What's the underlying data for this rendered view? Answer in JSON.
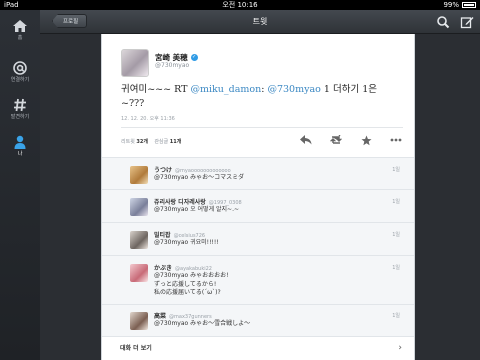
{
  "status_bar": {
    "device": "iPad",
    "time": "오전 10:16",
    "battery": "99%"
  },
  "sidebar": {
    "items": [
      {
        "label": "홈",
        "icon": "home-icon"
      },
      {
        "label": "연결하기",
        "icon": "at-icon"
      },
      {
        "label": "발견하기",
        "icon": "hashtag-icon"
      },
      {
        "label": "나",
        "icon": "person-icon"
      }
    ]
  },
  "header": {
    "back_label": "프로필",
    "title": "트윗",
    "icons": [
      "search-icon",
      "compose-icon"
    ]
  },
  "tweet": {
    "author_name": "宮崎 美穂",
    "handle": "@730myao",
    "text_prefix": "귀여미~~~ RT ",
    "mention1": "@miku_damon",
    "text_middle": ": ",
    "mention2": "@730myao",
    "text_suffix": " 1 더하기 1은 ~???",
    "timestamp": "12. 12. 20. 오후 11:36",
    "retweets_label": "리트윗",
    "retweets_count": "32개",
    "favorites_label": "관심글",
    "favorites_count": "11개",
    "actions": [
      "reply-icon",
      "retweet-icon",
      "favorite-icon",
      "more-icon"
    ]
  },
  "replies": [
    {
      "name": "うつけ",
      "handle": "@myaooooooooooooo",
      "text": "@730myao みゃお～コマスミダ",
      "time": "1일"
    },
    {
      "name": "쥬리사랑 디자레사랑",
      "handle": "@1997_0308",
      "text": "@730myao 오 어떻게 알지~.~",
      "time": "1일"
    },
    {
      "name": "밀티팝",
      "handle": "@celsius726",
      "text": "@730myao 귀요미!!!!!",
      "time": "1일"
    },
    {
      "name": "かぶき",
      "handle": "@ayakabuki22",
      "text": "@730myao みゃおおおお!\nずっと応援してるから!\n私の応援届いてる(´ω`)?",
      "time": "1일"
    },
    {
      "name": "高菜",
      "handle": "@max37gunners",
      "text": "@730myao みゃお～雪合戦しよ～",
      "time": "1일"
    }
  ],
  "footer": {
    "more_label": "대화 더 보기"
  }
}
